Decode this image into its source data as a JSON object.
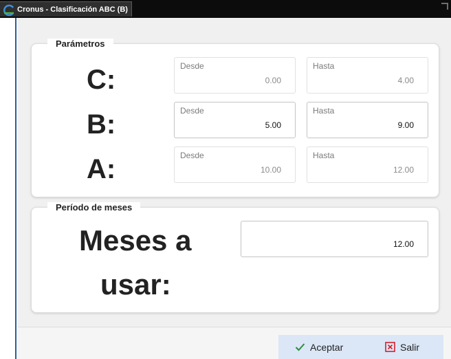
{
  "window": {
    "title": "Cronus - Clasificación ABC (B)",
    "icon": "app-logo-icon"
  },
  "parametros": {
    "legend": "Parámetros",
    "rows": [
      {
        "label": "C:",
        "desde_caption": "Desde",
        "desde_value": "0.00",
        "hasta_caption": "Hasta",
        "hasta_value": "4.00"
      },
      {
        "label": "B:",
        "desde_caption": "Desde",
        "desde_value": "5.00",
        "hasta_caption": "Hasta",
        "hasta_value": "9.00"
      },
      {
        "label": "A:",
        "desde_caption": "Desde",
        "desde_value": "10.00",
        "hasta_caption": "Hasta",
        "hasta_value": "12.00"
      }
    ]
  },
  "periodo": {
    "legend": "Período de meses",
    "label_line1": "Meses a",
    "label_line2": "usar:",
    "value": "12.00"
  },
  "footer": {
    "accept_label": "Aceptar",
    "accept_icon": "check-icon",
    "accept_color": "#2e8b3e",
    "exit_label": "Salir",
    "exit_icon": "close-box-icon",
    "exit_color": "#d21f2b"
  }
}
